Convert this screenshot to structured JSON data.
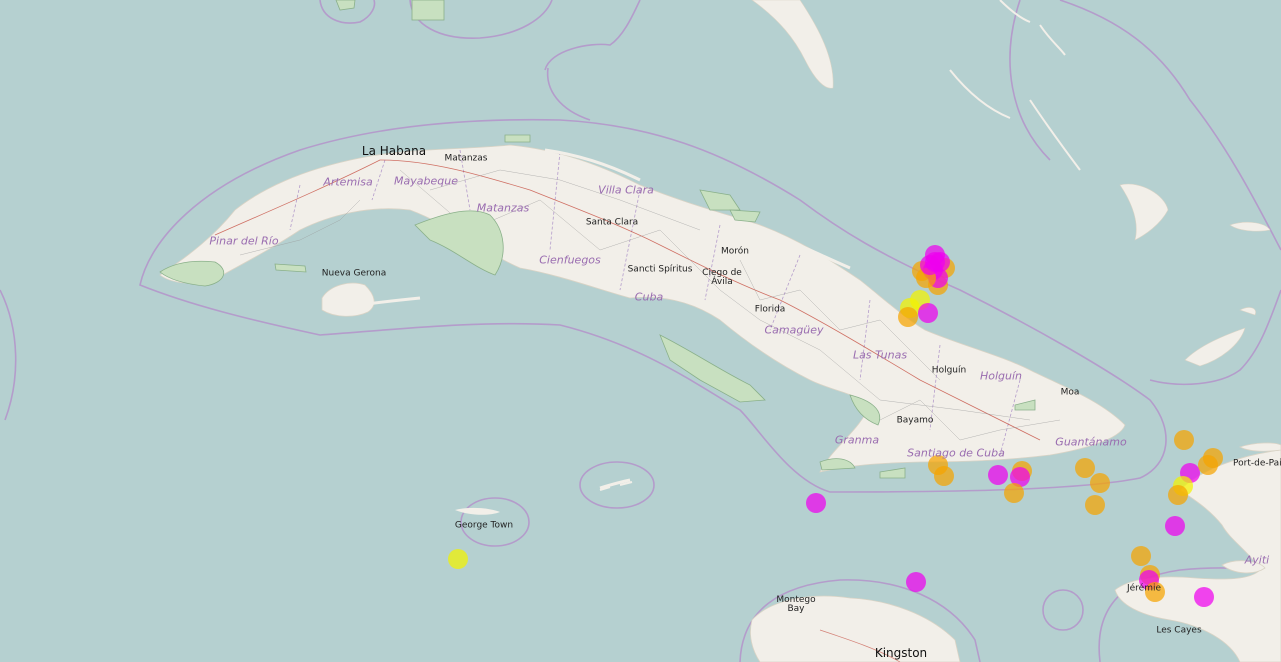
{
  "map": {
    "colors": {
      "water": "#b5d0d0",
      "land": "#f2efe9",
      "park": "#c8e0c0",
      "boundary": "#b49ccb",
      "road": "#c0392b"
    },
    "cities": [
      {
        "id": "la-habana",
        "name": "La Habana",
        "size": "large"
      },
      {
        "id": "matanzas",
        "name": "Matanzas"
      },
      {
        "id": "santa-clara",
        "name": "Santa Clara"
      },
      {
        "id": "sancti-spiritus",
        "name": "Sancti Spíritus"
      },
      {
        "id": "moron",
        "name": "Morón"
      },
      {
        "id": "ciego-de-avila",
        "name": "Ciego de Ávila"
      },
      {
        "id": "florida",
        "name": "Florida"
      },
      {
        "id": "holguin",
        "name": "Holguín"
      },
      {
        "id": "moa",
        "name": "Moa"
      },
      {
        "id": "bayamo",
        "name": "Bayamo"
      },
      {
        "id": "nueva-gerona",
        "name": "Nueva Gerona"
      },
      {
        "id": "george-town",
        "name": "George Town"
      },
      {
        "id": "montego-bay",
        "name": "Montego Bay"
      },
      {
        "id": "kingston",
        "name": "Kingston",
        "size": "large"
      },
      {
        "id": "port-de-paix",
        "name": "Port-de-Paix"
      },
      {
        "id": "jeremie",
        "name": "Jérémie"
      },
      {
        "id": "les-cayes",
        "name": "Les Cayes"
      }
    ],
    "regions": [
      {
        "id": "artemisa",
        "name": "Artemisa"
      },
      {
        "id": "mayabeque",
        "name": "Mayabeque"
      },
      {
        "id": "pinar-del-rio",
        "name": "Pinar del Río"
      },
      {
        "id": "matanzas-prov",
        "name": "Matanzas"
      },
      {
        "id": "villa-clara",
        "name": "Villa Clara"
      },
      {
        "id": "cienfuegos",
        "name": "Cienfuegos"
      },
      {
        "id": "cuba",
        "name": "Cuba"
      },
      {
        "id": "camaguey",
        "name": "Camagüey"
      },
      {
        "id": "las-tunas",
        "name": "Las Tunas"
      },
      {
        "id": "holguin-prov",
        "name": "Holguín"
      },
      {
        "id": "granma",
        "name": "Granma"
      },
      {
        "id": "santiago-de-cuba",
        "name": "Santiago de Cuba"
      },
      {
        "id": "guantanamo",
        "name": "Guantánamo"
      },
      {
        "id": "ayiti",
        "name": "Ayiti"
      }
    ],
    "marker_colors": {
      "magenta": "#ee00ee",
      "orange": "#f5a300",
      "yellow": "#f2f200"
    },
    "markers": [
      {
        "color": "orange"
      },
      {
        "color": "orange"
      },
      {
        "color": "orange"
      },
      {
        "color": "magenta"
      },
      {
        "color": "magenta"
      },
      {
        "color": "magenta"
      },
      {
        "color": "magenta"
      },
      {
        "color": "orange"
      },
      {
        "color": "magenta"
      },
      {
        "color": "yellow"
      },
      {
        "color": "yellow"
      },
      {
        "color": "orange"
      },
      {
        "color": "magenta"
      },
      {
        "color": "magenta"
      },
      {
        "color": "yellow"
      },
      {
        "color": "magenta"
      },
      {
        "color": "orange"
      },
      {
        "color": "orange"
      },
      {
        "color": "magenta"
      },
      {
        "color": "orange"
      },
      {
        "color": "magenta"
      },
      {
        "color": "orange"
      },
      {
        "color": "orange"
      },
      {
        "color": "orange"
      },
      {
        "color": "orange"
      },
      {
        "color": "orange"
      },
      {
        "color": "orange"
      },
      {
        "color": "magenta"
      },
      {
        "color": "yellow"
      },
      {
        "color": "orange"
      },
      {
        "color": "orange"
      },
      {
        "color": "magenta"
      },
      {
        "color": "orange"
      },
      {
        "color": "orange"
      },
      {
        "color": "magenta"
      },
      {
        "color": "orange"
      },
      {
        "color": "magenta"
      },
      {
        "color": "magenta"
      }
    ]
  }
}
